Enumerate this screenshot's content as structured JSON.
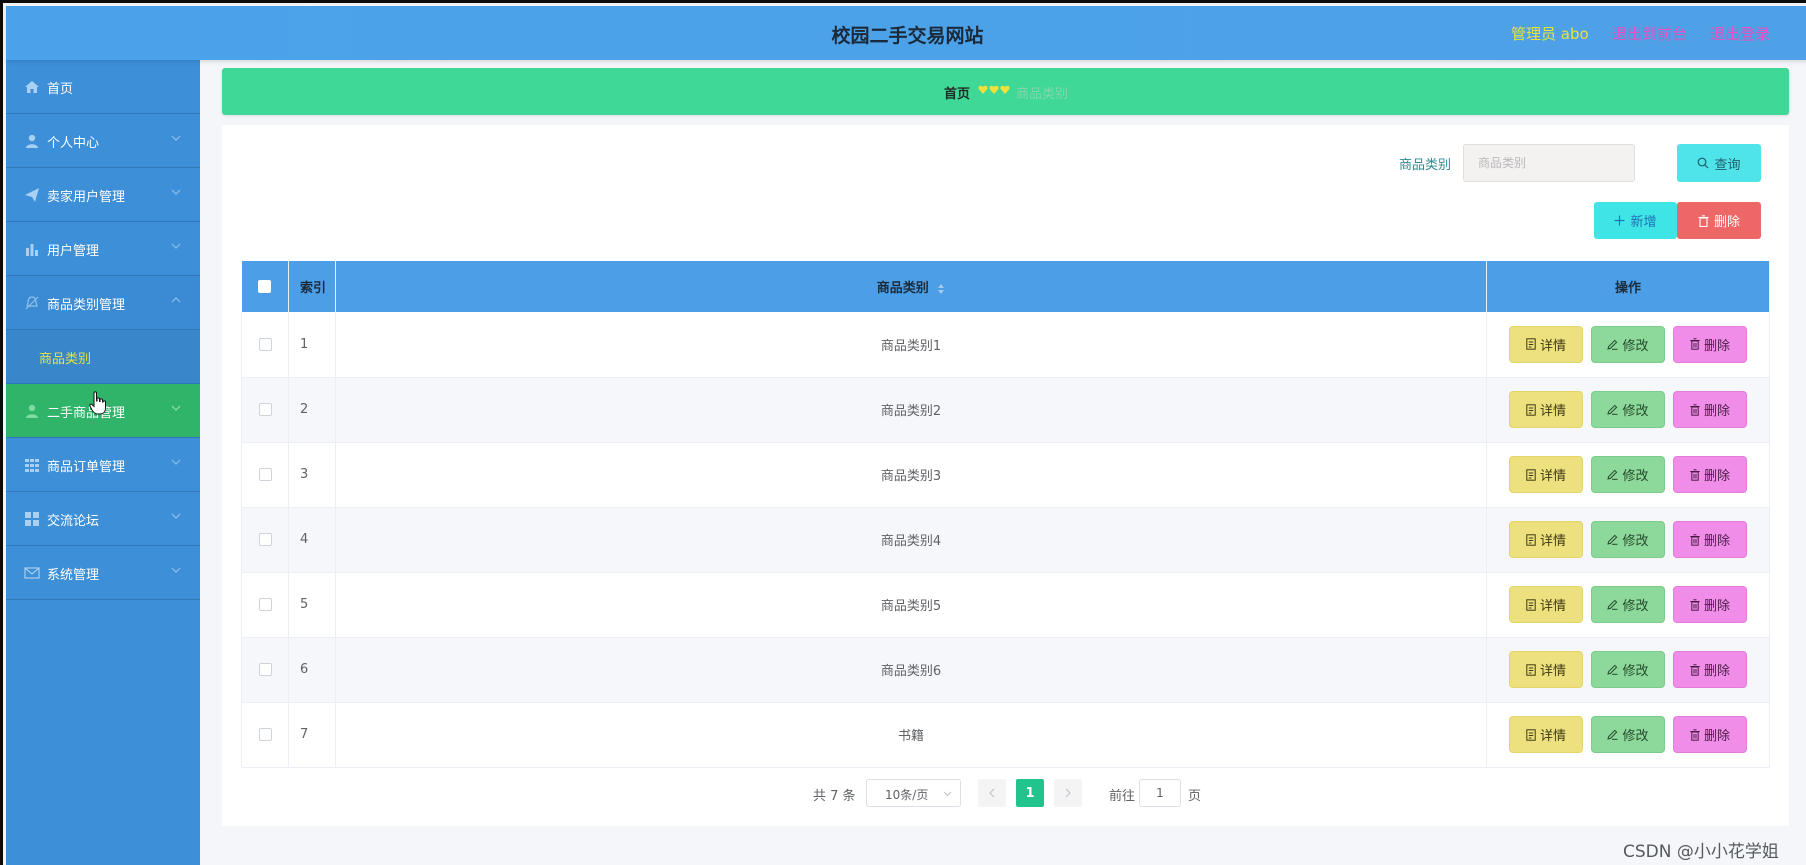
{
  "header": {
    "title": "校园二手交易网站",
    "admin": "管理员 abo",
    "back_front": "退出到前台",
    "logout": "退出登录"
  },
  "sidebar": {
    "items": [
      {
        "label": "首页",
        "icon": "home-icon"
      },
      {
        "label": "个人中心",
        "icon": "user-icon"
      },
      {
        "label": "卖家用户管理",
        "icon": "send-icon"
      },
      {
        "label": "用户管理",
        "icon": "bar-chart-icon"
      },
      {
        "label": "商品类别管理",
        "icon": "bell-off-icon"
      },
      {
        "label": "二手商品管理",
        "icon": "user-icon"
      },
      {
        "label": "商品订单管理",
        "icon": "grid-icon"
      },
      {
        "label": "交流论坛",
        "icon": "apps-icon"
      },
      {
        "label": "系统管理",
        "icon": "mail-icon"
      }
    ],
    "submenu_item": "商品类别"
  },
  "breadcrumb": {
    "home": "首页",
    "current": "商品类别"
  },
  "search": {
    "label": "商品类别",
    "placeholder": "商品类别",
    "query_button": "查询"
  },
  "actions": {
    "add_button": "新增",
    "delete_button": "删除"
  },
  "table": {
    "columns": [
      "索引",
      "商品类别",
      "操作"
    ],
    "rows": [
      {
        "index": "1",
        "category": "商品类别1"
      },
      {
        "index": "2",
        "category": "商品类别2"
      },
      {
        "index": "3",
        "category": "商品类别3"
      },
      {
        "index": "4",
        "category": "商品类别4"
      },
      {
        "index": "5",
        "category": "商品类别5"
      },
      {
        "index": "6",
        "category": "商品类别6"
      },
      {
        "index": "7",
        "category": "书籍"
      }
    ],
    "row_actions": {
      "detail": "详情",
      "edit": "修改",
      "remove": "删除"
    }
  },
  "pagination": {
    "total": "共 7 条",
    "page_size": "10条/页",
    "current_page": "1",
    "goto_label": "前往",
    "goto_value": "1",
    "page_word": "页"
  },
  "watermark": "CSDN @小小花学姐",
  "colors": {
    "header": "#4aa3ea",
    "sidebar": "#3d8fd8",
    "sidebar_active": "#2fb46a",
    "breadcrumb": "#3fd896",
    "table_header": "#4c9fe7",
    "detail_btn": "#ece07f",
    "edit_btn": "#8dd89b",
    "remove_btn": "#f08de8",
    "query_btn": "#4fe3ea",
    "add_btn": "#3fe5e6",
    "delete_btn": "#ee6767"
  }
}
